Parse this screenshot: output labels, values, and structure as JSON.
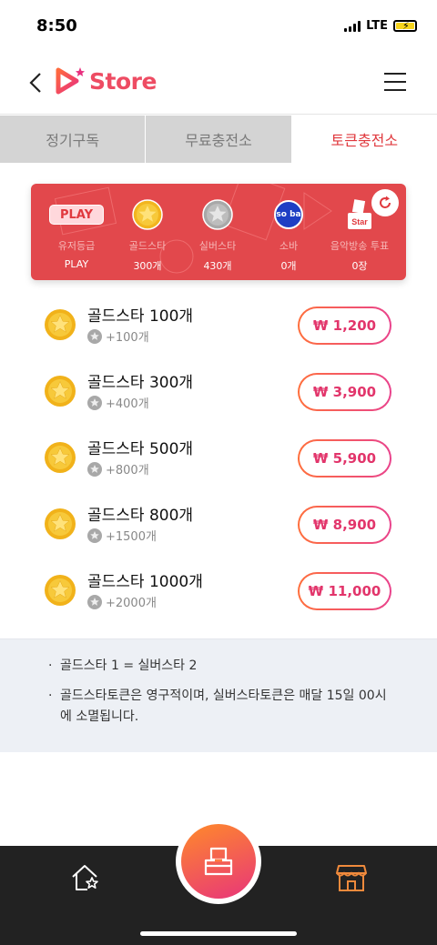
{
  "status_bar": {
    "time": "8:50",
    "network": "LTE"
  },
  "header": {
    "brand": "Store"
  },
  "tabs": [
    {
      "label": "정기구독",
      "active": false
    },
    {
      "label": "무료충전소",
      "active": false
    },
    {
      "label": "토큰충전소",
      "active": true
    }
  ],
  "token_card": {
    "items": [
      {
        "icon": "play-badge",
        "badge_text": "PLAY",
        "label": "유저등급",
        "value": "PLAY"
      },
      {
        "icon": "gold-star-coin-icon",
        "label": "골드스타",
        "value": "300개"
      },
      {
        "icon": "silver-star-coin-icon",
        "label": "실버스타",
        "value": "430개"
      },
      {
        "icon": "soba-icon",
        "badge_text": "so ba",
        "label": "소바",
        "value": "0개"
      },
      {
        "icon": "music-vote-icon",
        "badge_text": "Star",
        "label": "음악방송 투표",
        "value": "0장"
      }
    ]
  },
  "products": [
    {
      "name": "골드스타 100개",
      "bonus": "+100개",
      "price": "₩ 1,200"
    },
    {
      "name": "골드스타 300개",
      "bonus": "+400개",
      "price": "₩ 3,900"
    },
    {
      "name": "골드스타 500개",
      "bonus": "+800개",
      "price": "₩ 5,900"
    },
    {
      "name": "골드스타 800개",
      "bonus": "+1500개",
      "price": "₩ 8,900"
    },
    {
      "name": "골드스타 1000개",
      "bonus": "+2000개",
      "price": "₩ 11,000"
    }
  ],
  "notes": [
    "골드스타 1 = 실버스타 2",
    "골드스타토큰은 영구적이며, 실버스타토큰은 매달 15일 00시에 소멸됩니다."
  ],
  "colors": {
    "accent": "#e0393e",
    "card_bg": "#e2484c",
    "price_gradient_start": "#ff6f3c",
    "price_gradient_end": "#e9428c"
  }
}
